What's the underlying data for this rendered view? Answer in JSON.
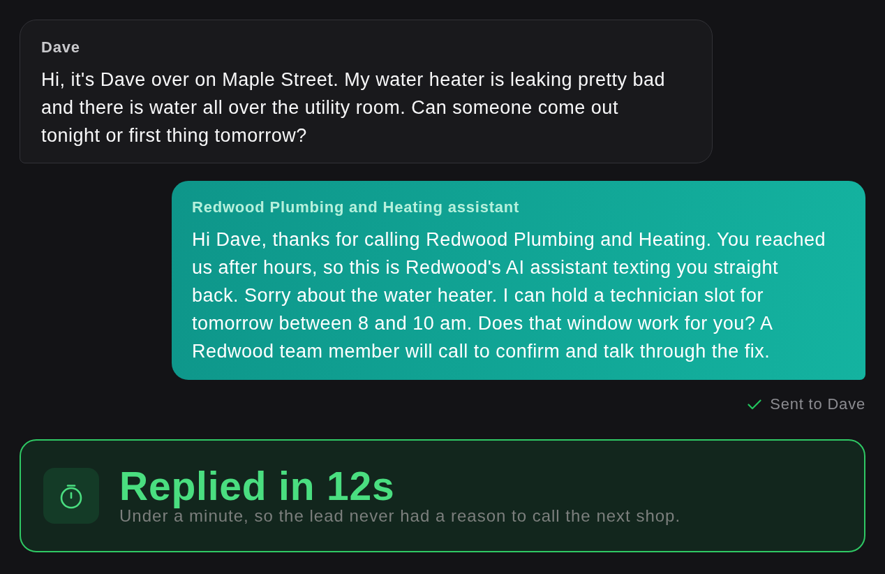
{
  "messages": [
    {
      "kind": "incoming",
      "sender": "Dave",
      "text": "Hi, it's Dave over on Maple Street. My water heater is leaking pretty bad and there is water all over the utility room. Can someone come out tonight or first thing tomorrow?"
    },
    {
      "kind": "outgoing",
      "sender": "Redwood Plumbing and Heating assistant",
      "text": "Hi Dave, thanks for calling Redwood Plumbing and Heating. You reached us after hours, so this is Redwood's AI assistant texting you straight back. Sorry about the water heater. I can hold a technician slot for tomorrow between 8 and 10 am. Does that window work for you? A Redwood team member will call to confirm and talk through the fix.",
      "status": "Sent to Dave"
    }
  ],
  "response_card": {
    "title": "Replied in 12s",
    "subtitle": "Under a minute, so the lead never had a reason to call the next shop."
  }
}
